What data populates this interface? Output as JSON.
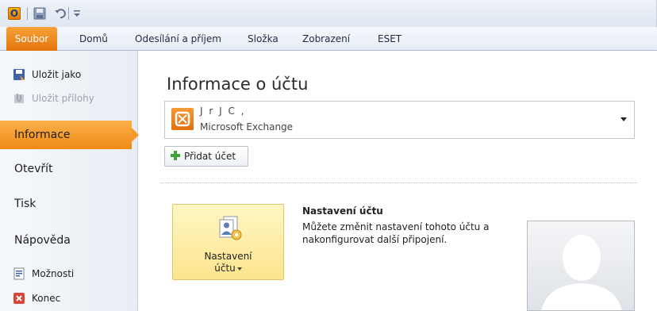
{
  "quick_access": {
    "app_icon_letter": "O",
    "icons": [
      "outlook-app-icon",
      "save-icon",
      "undo-icon",
      "customize-qat-icon"
    ]
  },
  "ribbon": {
    "tabs": [
      {
        "label": "Soubor",
        "active": true
      },
      {
        "label": "Domů"
      },
      {
        "label": "Odesílání a příjem"
      },
      {
        "label": "Složka"
      },
      {
        "label": "Zobrazení"
      },
      {
        "label": "ESET"
      }
    ]
  },
  "nav": {
    "commands_top": [
      {
        "label": "Uložit jako",
        "icon": "save-as-icon",
        "disabled": false
      },
      {
        "label": "Uložit přílohy",
        "icon": "save-attachments-icon",
        "disabled": true
      }
    ],
    "tabs": [
      {
        "label": "Informace",
        "active": true
      },
      {
        "label": "Otevřít"
      },
      {
        "label": "Tisk"
      },
      {
        "label": "Nápověda"
      }
    ],
    "commands_bottom": [
      {
        "label": "Možnosti",
        "icon": "options-icon"
      },
      {
        "label": "Konec",
        "icon": "exit-icon"
      }
    ]
  },
  "main": {
    "title": "Informace o účtu",
    "account": {
      "name": "J    r  J  C    ,",
      "type": "Microsoft Exchange"
    },
    "add_account_label": "Přidat účet",
    "settings": {
      "button_line1": "Nastavení",
      "button_line2": "účtu",
      "heading": "Nastavení účtu",
      "description": "Můžete změnit nastavení tohoto účtu a nakonfigurovat další připojení."
    }
  },
  "colors": {
    "accent_orange": "#f08a16",
    "file_tab": "#e4740c",
    "button_hover": "#fde58f"
  }
}
